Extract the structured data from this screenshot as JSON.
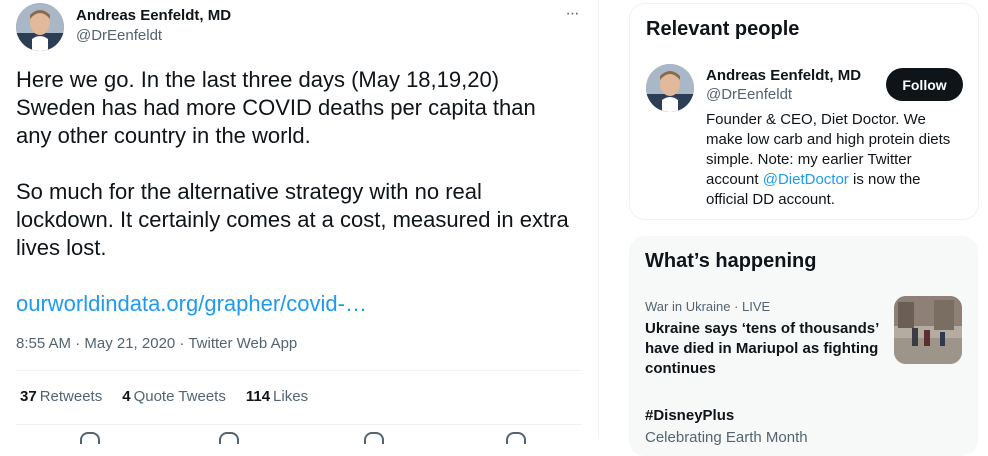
{
  "tweet": {
    "author_name": "Andreas Eenfeldt, MD",
    "author_handle": "@DrEenfeldt",
    "more_icon": "···",
    "paragraph1": "Here we go. In the last three days (May 18,19,20) Sweden has had more COVID deaths per capita than any other country in the world.",
    "paragraph2": "So much for the alternative strategy with no real lockdown. It certainly comes at a cost, measured in extra lives lost.",
    "link_text": "ourworldindata.org/grapher/covid-…",
    "timestamp": "8:55 AM · May 21, 2020 · Twitter Web App",
    "stats": {
      "retweets_count": "37",
      "retweets_label": "Retweets",
      "quotes_count": "4",
      "quotes_label": "Quote Tweets",
      "likes_count": "114",
      "likes_label": "Likes"
    }
  },
  "relevant_people": {
    "title": "Relevant people",
    "name": "Andreas Eenfeldt, MD",
    "handle": "@DrEenfeldt",
    "follow_label": "Follow",
    "bio_before": "Founder & CEO, Diet Doctor. We make low carb and high protein diets simple. Note: my earlier Twitter account ",
    "bio_mention": "@DietDoctor",
    "bio_after": " is now the official DD account."
  },
  "whats_happening": {
    "title": "What’s happening",
    "trend1_category": "War in Ukraine · LIVE",
    "trend1_title": "Ukraine says ‘tens of thousands’ have died in Mariupol as fighting continues",
    "trend2_title": "#DisneyPlus",
    "trend2_sub": "Celebrating Earth Month"
  },
  "colors": {
    "link": "#1d9bf0",
    "text": "#0f1419",
    "secondary": "#536471"
  }
}
